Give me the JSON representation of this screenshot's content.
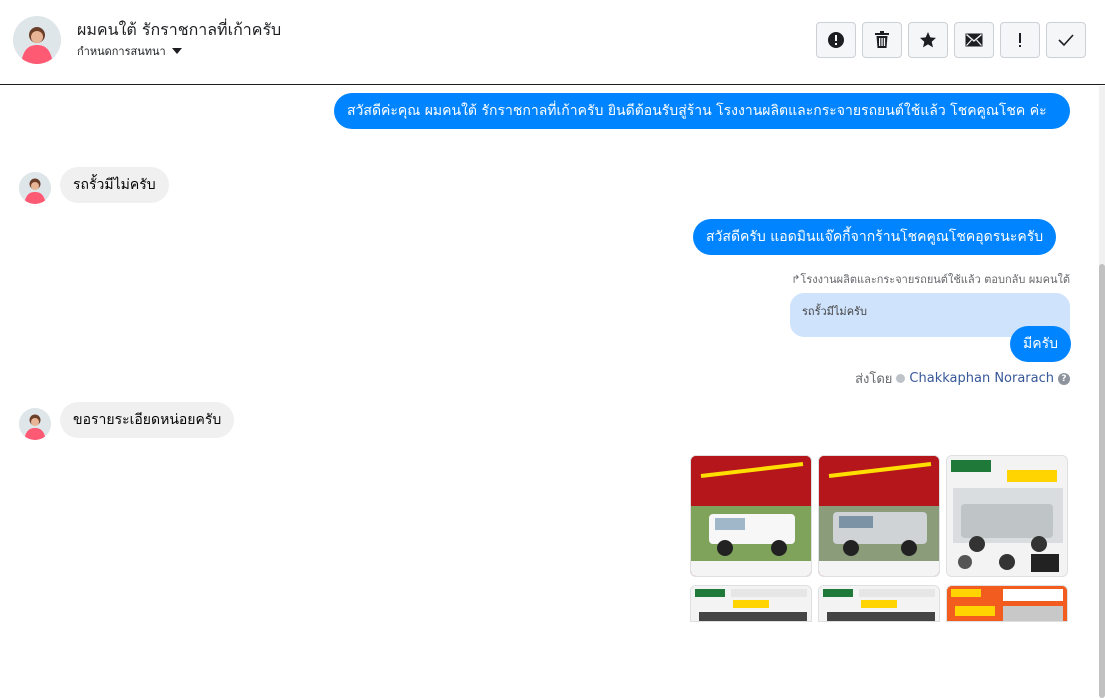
{
  "header": {
    "contact_name": "ผมคนใต้ รักราชกาลที่เก้าครับ",
    "subtitle": "กำหนดการสนทนา",
    "toolbar": [
      {
        "name": "spam-button",
        "icon": "alert-circle-icon"
      },
      {
        "name": "delete-button",
        "icon": "trash-icon"
      },
      {
        "name": "star-button",
        "icon": "star-icon"
      },
      {
        "name": "mark-unread-button",
        "icon": "envelope-icon"
      },
      {
        "name": "important-button",
        "icon": "exclamation-icon"
      },
      {
        "name": "done-button",
        "icon": "check-icon"
      }
    ]
  },
  "messages": {
    "m1": {
      "direction": "out",
      "text": "สวัสดีค่ะคุณ ผมคนใต้ รักราชกาลที่เก้าครับ ยินดีต้อนรับสู่ร้าน โรงงานผลิตและกระจายรถยนต์ใช้แล้ว โชคคูณโชค ค่ะ"
    },
    "m2": {
      "direction": "in",
      "text": "รถรั้วมีไม่ครับ"
    },
    "m3": {
      "direction": "out",
      "text": "สวัสดีครับ แอดมินแจ๊คกี้จากร้านโชคคูณโชคอุดรนะครับ"
    },
    "reply_meta": "โรงงานผลิตและกระจายรถยนต์ใช้แล้ว ตอบกลับ ผมคนใต้",
    "reply_quote": "รถรั้วมีไม่ครับ",
    "m4": {
      "direction": "out",
      "text": "มีครับ"
    },
    "sent_by_label": "ส่งโดย",
    "sent_by_name": "Chakkaphan Norarach",
    "help_glyph": "?",
    "m5": {
      "direction": "in",
      "text": "ขอรายระเอียดหน่อยครับ"
    }
  },
  "colors": {
    "outgoing_bubble": "#0084ff",
    "incoming_bubble": "#f0f0f0",
    "reply_quote_bg": "#cfe3fc"
  }
}
